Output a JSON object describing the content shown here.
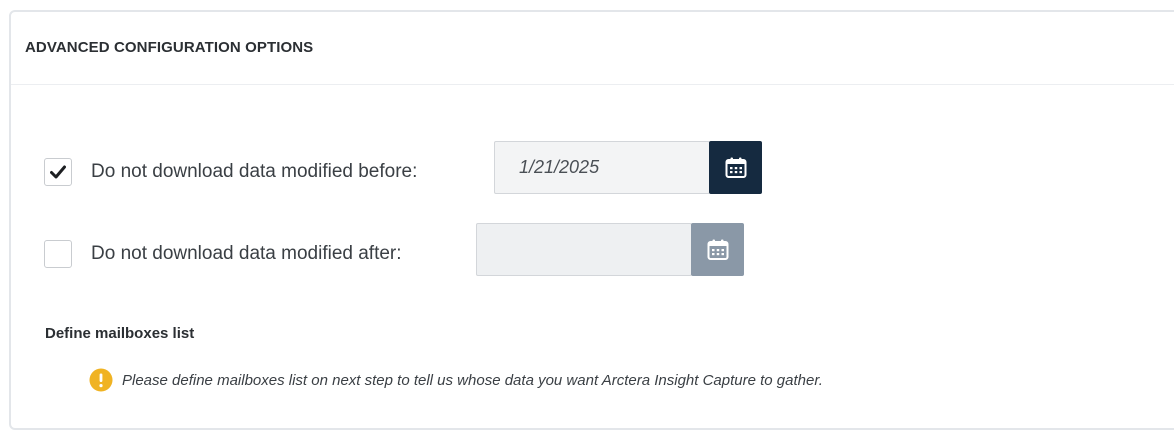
{
  "panel": {
    "title": "ADVANCED CONFIGURATION OPTIONS"
  },
  "options": {
    "before": {
      "checked": true,
      "label": "Do not download data modified before:",
      "date_value": "1/21/2025",
      "calendar_icon": "calendar-icon"
    },
    "after": {
      "checked": false,
      "label": "Do not download data modified after:",
      "date_value": "",
      "calendar_icon": "calendar-icon"
    }
  },
  "mailboxes": {
    "title": "Define mailboxes list",
    "notice_icon": "warning-icon",
    "notice": "Please define mailboxes list on next step to tell us whose data you want Arctera Insight Capture to gather."
  },
  "colors": {
    "calendar_active": "#152a40",
    "calendar_disabled": "#8a98a7",
    "warning": "#f0b323"
  }
}
